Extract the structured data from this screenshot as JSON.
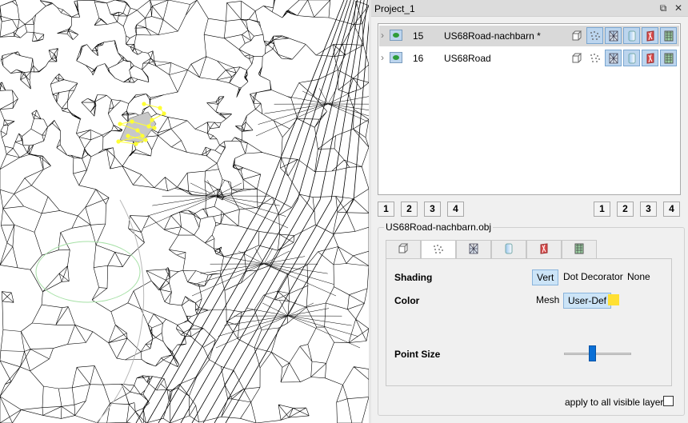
{
  "viewport": {
    "wire_color": "#000000",
    "selection_color": "#ffff33",
    "background": "#ffffff"
  },
  "panel": {
    "title": "Project_1",
    "float_icon": "float-icon",
    "close_icon": "close-icon"
  },
  "layers": [
    {
      "num": "15",
      "name": "US68Road-nachbarn *",
      "selected": true,
      "modes": [
        false,
        true,
        true,
        true,
        true,
        true
      ]
    },
    {
      "num": "16",
      "name": "US68Road",
      "selected": false,
      "modes": [
        false,
        false,
        true,
        true,
        true,
        true
      ]
    }
  ],
  "mode_icons": [
    "box-icon",
    "points-icon",
    "wireframe-icon",
    "shaded-icon",
    "texture-icon",
    "decoration-icon"
  ],
  "preset_buttons_left": [
    "1",
    "2",
    "3",
    "4"
  ],
  "preset_buttons_right": [
    "1",
    "2",
    "3",
    "4"
  ],
  "filename": "US68Road-nachbarn.obj",
  "tabs": {
    "icons": [
      "box-icon",
      "points-icon",
      "wireframe-icon",
      "shaded-icon",
      "texture-icon",
      "decoration-icon"
    ],
    "active_index": 1
  },
  "settings": {
    "shading_label": "Shading",
    "shading_options": [
      "Vert",
      "Dot Decorator",
      "None"
    ],
    "shading_selected": "Vert",
    "color_label": "Color",
    "color_options": [
      "Mesh",
      "User-Def"
    ],
    "color_selected": "User-Def",
    "user_color": "#ffe033",
    "point_size_label": "Point Size",
    "point_size_level": 0.42
  },
  "apply_all_label": "apply to all visible layers",
  "apply_all_checked": false
}
